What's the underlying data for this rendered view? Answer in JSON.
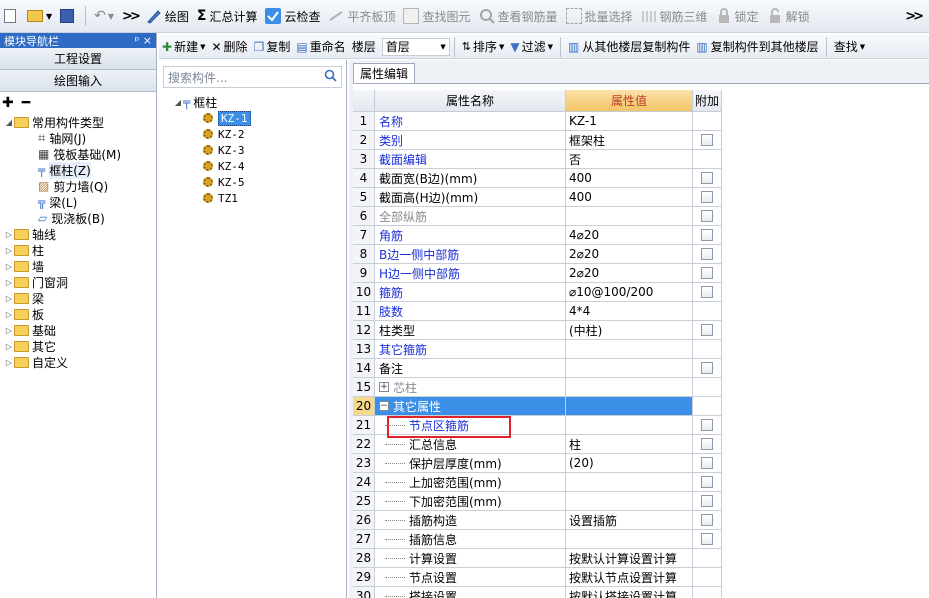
{
  "toolbar": {
    "items": [
      {
        "label": "绘图",
        "icon": "draw-icon",
        "disabled": false
      },
      {
        "label": "汇总计算",
        "icon": "sigma-icon",
        "disabled": false
      },
      {
        "label": "云检查",
        "icon": "cloud-check-icon",
        "disabled": false
      },
      {
        "label": "平齐板顶",
        "icon": "align-top-icon",
        "disabled": true
      },
      {
        "label": "查找图元",
        "icon": "find-element-icon",
        "disabled": true
      },
      {
        "label": "查看钢筋量",
        "icon": "view-rebar-icon",
        "disabled": true
      },
      {
        "label": "批量选择",
        "icon": "batch-select-icon",
        "disabled": true
      },
      {
        "label": "钢筋三维",
        "icon": "rebar-3d-icon",
        "disabled": true
      },
      {
        "label": "锁定",
        "icon": "lock-icon",
        "disabled": true
      },
      {
        "label": "解锁",
        "icon": "unlock-icon",
        "disabled": true
      }
    ],
    "more": ">>"
  },
  "left_panel": {
    "title": "模块导航栏",
    "pin": "ᵖ ×",
    "btn_project": "工程设置",
    "btn_draw": "绘图输入",
    "tree": {
      "root": "常用构件类型",
      "children": [
        "轴网(J)",
        "筏板基础(M)",
        "框柱(Z)",
        "剪力墙(Q)",
        "梁(L)",
        "现浇板(B)"
      ],
      "folders": [
        "轴线",
        "柱",
        "墙",
        "门窗洞",
        "梁",
        "板",
        "基础",
        "其它",
        "自定义"
      ]
    }
  },
  "toolbar2": {
    "new": "新建",
    "delete": "删除",
    "copy": "复制",
    "rename": "重命名",
    "floor_label": "楼层",
    "floor_value": "首层",
    "sort": "排序",
    "filter": "过滤",
    "copy_from": "从其他楼层复制构件",
    "copy_to": "复制构件到其他楼层",
    "find": "查找"
  },
  "component_tree": {
    "search_placeholder": "搜索构件...",
    "root": "框柱",
    "items": [
      "KZ-1",
      "KZ-2",
      "KZ-3",
      "KZ-4",
      "KZ-5",
      "TZ1"
    ],
    "selected": "KZ-1"
  },
  "properties": {
    "tab": "属性编辑",
    "headers": {
      "name": "属性名称",
      "value": "属性值",
      "extra": "附加"
    },
    "rows": [
      {
        "n": "1",
        "name": "名称",
        "value": "KZ-1",
        "style": "blue",
        "check": false
      },
      {
        "n": "2",
        "name": "类别",
        "value": "框架柱",
        "style": "blue",
        "check": true
      },
      {
        "n": "3",
        "name": "截面编辑",
        "value": "否",
        "style": "blue",
        "check": false
      },
      {
        "n": "4",
        "name": "截面宽(B边)(mm)",
        "value": "400",
        "style": "",
        "check": true
      },
      {
        "n": "5",
        "name": "截面高(H边)(mm)",
        "value": "400",
        "style": "",
        "check": true
      },
      {
        "n": "6",
        "name": "全部纵筋",
        "value": "",
        "style": "gray",
        "check": true
      },
      {
        "n": "7",
        "name": "角筋",
        "value": "4⌀20",
        "style": "blue",
        "check": true
      },
      {
        "n": "8",
        "name": "B边一侧中部筋",
        "value": "2⌀20",
        "style": "blue",
        "check": true
      },
      {
        "n": "9",
        "name": "H边一侧中部筋",
        "value": "2⌀20",
        "style": "blue",
        "check": true
      },
      {
        "n": "10",
        "name": "箍筋",
        "value": "⌀10@100/200",
        "style": "blue",
        "check": true
      },
      {
        "n": "11",
        "name": "肢数",
        "value": "4*4",
        "style": "blue",
        "check": false
      },
      {
        "n": "12",
        "name": "柱类型",
        "value": "(中柱)",
        "style": "",
        "check": true
      },
      {
        "n": "13",
        "name": "其它箍筋",
        "value": "",
        "style": "blue",
        "check": false
      },
      {
        "n": "14",
        "name": "备注",
        "value": "",
        "style": "",
        "check": true
      },
      {
        "n": "15",
        "name": "芯柱",
        "value": "",
        "style": "gray",
        "check": false,
        "expander": "+"
      },
      {
        "n": "20",
        "name": "其它属性",
        "value": "",
        "style": "selected",
        "check": false,
        "expander": "−"
      },
      {
        "n": "21",
        "name": "节点区箍筋",
        "value": "",
        "style": "blue-sub",
        "check": true
      },
      {
        "n": "22",
        "name": "汇总信息",
        "value": "柱",
        "style": "sub",
        "check": true
      },
      {
        "n": "23",
        "name": "保护层厚度(mm)",
        "value": "(20)",
        "style": "sub",
        "check": true
      },
      {
        "n": "24",
        "name": "上加密范围(mm)",
        "value": "",
        "style": "sub",
        "check": true
      },
      {
        "n": "25",
        "name": "下加密范围(mm)",
        "value": "",
        "style": "sub",
        "check": true
      },
      {
        "n": "26",
        "name": "插筋构造",
        "value": "设置插筋",
        "style": "sub",
        "check": true
      },
      {
        "n": "27",
        "name": "插筋信息",
        "value": "",
        "style": "sub",
        "check": true
      },
      {
        "n": "28",
        "name": "计算设置",
        "value": "按默认计算设置计算",
        "style": "sub",
        "check": false
      },
      {
        "n": "29",
        "name": "节点设置",
        "value": "按默认节点设置计算",
        "style": "sub",
        "check": false
      },
      {
        "n": "30",
        "name": "搭接设置",
        "value": "按默认搭接设置计算",
        "style": "sub",
        "check": false
      }
    ]
  },
  "colors": {
    "accent": "#2d6bc4",
    "selected_row": "#3b8fe6",
    "highlight_box": "#e0232b",
    "value_header": "#f5c873"
  }
}
